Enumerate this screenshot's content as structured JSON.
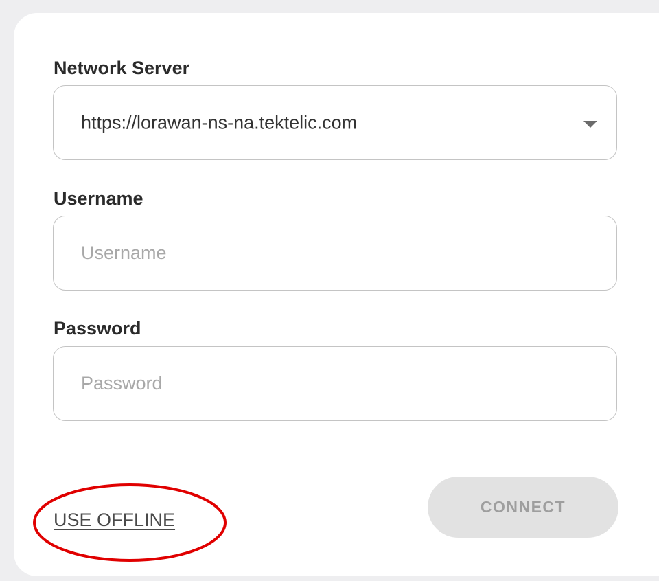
{
  "form": {
    "network_server": {
      "label": "Network Server",
      "value": "https://lorawan-ns-na.tektelic.com",
      "icon": "caret-down-icon"
    },
    "username": {
      "label": "Username",
      "placeholder": "Username",
      "value": ""
    },
    "password": {
      "label": "Password",
      "placeholder": "Password",
      "value": ""
    },
    "offline_link": "USE OFFLINE",
    "connect_button": "CONNECT"
  },
  "colors": {
    "page_background": "#eeeef0",
    "card_background": "#ffffff",
    "field_border": "#c4c4c4",
    "button_disabled_background": "#e2e2e2",
    "button_disabled_text": "#9e9e9e",
    "annotation_ellipse": "#e00000"
  }
}
